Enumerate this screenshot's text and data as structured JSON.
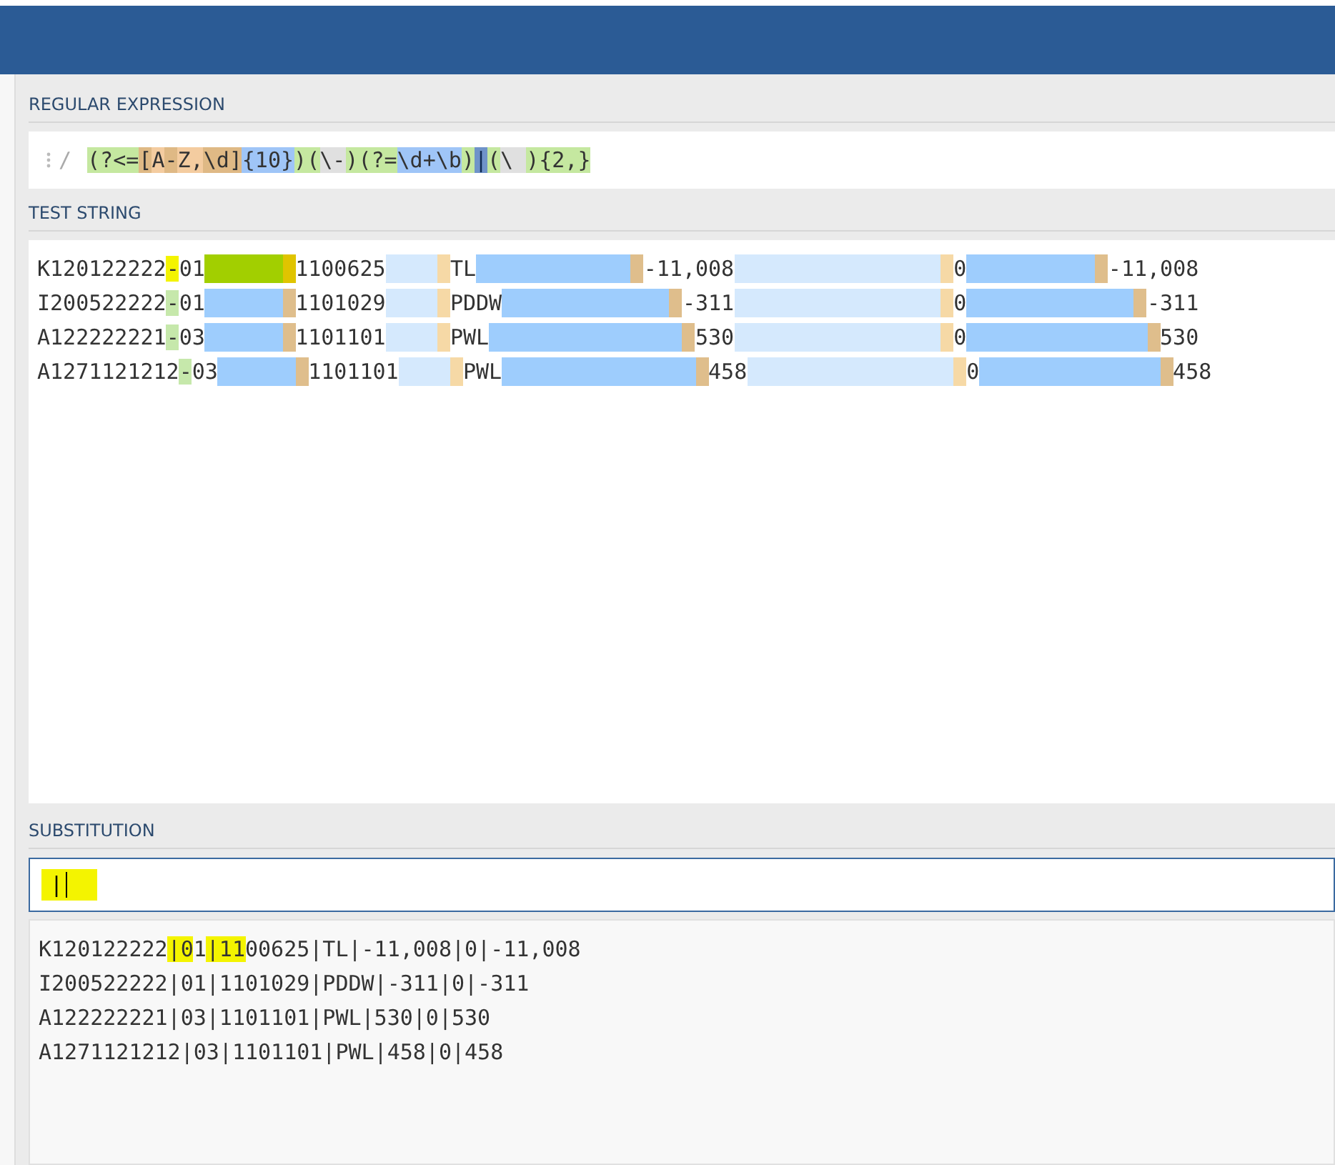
{
  "regex": {
    "label": "REGULAR EXPRESSION",
    "delimiter": "/",
    "tokens": [
      {
        "kind": "group",
        "text": "(?<="
      },
      {
        "kind": "set-meta",
        "text": "["
      },
      {
        "kind": "set",
        "text": "A"
      },
      {
        "kind": "set-meta",
        "text": "-"
      },
      {
        "kind": "set",
        "text": "Z,"
      },
      {
        "kind": "set-meta",
        "text": "\\d"
      },
      {
        "kind": "set-meta",
        "text": "]"
      },
      {
        "kind": "quant",
        "text": "{10}"
      },
      {
        "kind": "group",
        "text": ")"
      },
      {
        "kind": "group",
        "text": "("
      },
      {
        "kind": "escape",
        "text": "\\-"
      },
      {
        "kind": "group",
        "text": ")"
      },
      {
        "kind": "group",
        "text": "(?="
      },
      {
        "kind": "quant",
        "text": "\\d+\\b"
      },
      {
        "kind": "group",
        "text": ")"
      },
      {
        "kind": "alt",
        "text": "|"
      },
      {
        "kind": "group",
        "text": "("
      },
      {
        "kind": "escape",
        "text": "\\ "
      },
      {
        "kind": "group",
        "text": ")"
      },
      {
        "kind": "group",
        "text": "{2,}"
      }
    ]
  },
  "test": {
    "label": "TEST STRING",
    "lines": [
      [
        {
          "kind": "plain",
          "text": "K120122222"
        },
        {
          "kind": "group",
          "text": "-",
          "marked": true
        },
        {
          "kind": "plain",
          "text": "01"
        },
        {
          "kind": "match",
          "marked": true
        },
        {
          "kind": "plain",
          "text": "1100625"
        },
        {
          "kind": "match-alt"
        },
        {
          "kind": "plain",
          "text": "TL"
        },
        {
          "kind": "match"
        },
        {
          "kind": "plain",
          "text": "-11,008"
        },
        {
          "kind": "match-alt"
        },
        {
          "kind": "plain",
          "text": "0"
        },
        {
          "kind": "match"
        },
        {
          "kind": "plain",
          "text": "-11,008"
        }
      ],
      [
        {
          "kind": "plain",
          "text": "I200522222"
        },
        {
          "kind": "group",
          "text": "-"
        },
        {
          "kind": "plain",
          "text": "01"
        },
        {
          "kind": "match"
        },
        {
          "kind": "plain",
          "text": "1101029"
        },
        {
          "kind": "match-alt"
        },
        {
          "kind": "plain",
          "text": "PDDW"
        },
        {
          "kind": "match"
        },
        {
          "kind": "plain",
          "text": "-311"
        },
        {
          "kind": "match-alt"
        },
        {
          "kind": "plain",
          "text": "0"
        },
        {
          "kind": "match"
        },
        {
          "kind": "plain",
          "text": "-311"
        }
      ],
      [
        {
          "kind": "plain",
          "text": "A122222221"
        },
        {
          "kind": "group",
          "text": "-"
        },
        {
          "kind": "plain",
          "text": "03"
        },
        {
          "kind": "match"
        },
        {
          "kind": "plain",
          "text": "1101101"
        },
        {
          "kind": "match-alt"
        },
        {
          "kind": "plain",
          "text": "PWL"
        },
        {
          "kind": "match"
        },
        {
          "kind": "plain",
          "text": "530"
        },
        {
          "kind": "match-alt"
        },
        {
          "kind": "plain",
          "text": "0"
        },
        {
          "kind": "match"
        },
        {
          "kind": "plain",
          "text": "530"
        }
      ],
      [
        {
          "kind": "plain",
          "text": "A1271121212"
        },
        {
          "kind": "group",
          "text": "-"
        },
        {
          "kind": "plain",
          "text": "03"
        },
        {
          "kind": "match"
        },
        {
          "kind": "plain",
          "text": "1101101"
        },
        {
          "kind": "match-alt"
        },
        {
          "kind": "plain",
          "text": "PWL"
        },
        {
          "kind": "match"
        },
        {
          "kind": "plain",
          "text": "458"
        },
        {
          "kind": "match-alt"
        },
        {
          "kind": "plain",
          "text": "0"
        },
        {
          "kind": "match"
        },
        {
          "kind": "plain",
          "text": "458"
        }
      ]
    ]
  },
  "substitution": {
    "label": "SUBSTITUTION",
    "value": "|",
    "marked": true,
    "result_lines": [
      [
        {
          "text": "K120122222",
          "marked": false
        },
        {
          "text": "|0",
          "marked": true
        },
        {
          "text": "1",
          "marked": false
        },
        {
          "text": "|11",
          "marked": true
        },
        {
          "text": "00625|TL|-11,008|0|-11,008",
          "marked": false
        }
      ],
      [
        {
          "text": "I200522222|01|1101029|PDDW|-311|0|-311",
          "marked": false
        }
      ],
      [
        {
          "text": "A122222221|03|1101101|PWL|530|0|530",
          "marked": false
        }
      ],
      [
        {
          "text": "A1271121212|03|1101101|PWL|458|0|458",
          "marked": false
        }
      ]
    ]
  }
}
